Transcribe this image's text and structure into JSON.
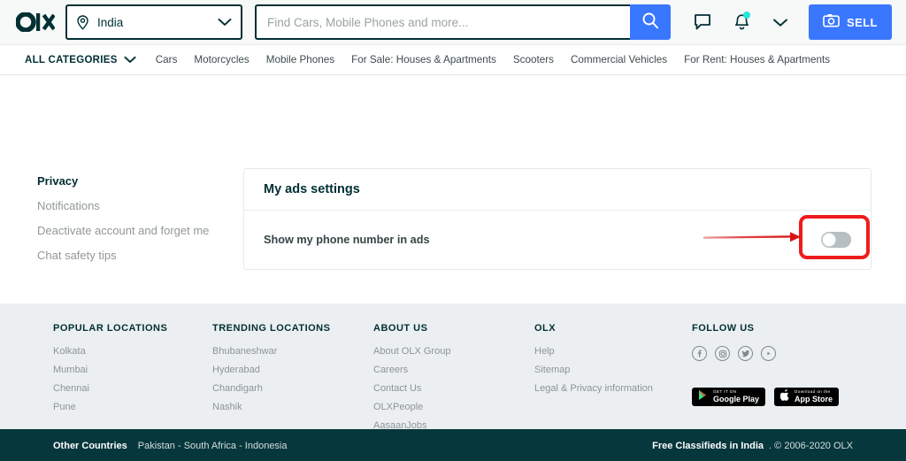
{
  "header": {
    "logo_alt": "olx-logo",
    "location": {
      "value": "India",
      "icon": "location-pin-icon",
      "chevron": "chevron-down-icon"
    },
    "search": {
      "placeholder": "Find Cars, Mobile Phones and more...",
      "value": "",
      "button_icon": "search-icon"
    },
    "icons": [
      {
        "name": "chat-icon",
        "badge": false
      },
      {
        "name": "bell-icon",
        "badge": true
      },
      {
        "name": "chevron-down-icon",
        "badge": false
      }
    ],
    "sell": {
      "label": "SELL",
      "icon": "camera-icon"
    }
  },
  "categories": {
    "all_label": "ALL CATEGORIES",
    "all_icon": "chevron-down-icon",
    "items": [
      "Cars",
      "Motorcycles",
      "Mobile Phones",
      "For Sale: Houses & Apartments",
      "Scooters",
      "Commercial Vehicles",
      "For Rent: Houses & Apartments"
    ]
  },
  "sidebar": {
    "items": [
      {
        "label": "Privacy",
        "active": true
      },
      {
        "label": "Notifications",
        "active": false
      },
      {
        "label": "Deactivate account and forget me",
        "active": false
      },
      {
        "label": "Chat safety tips",
        "active": false
      }
    ]
  },
  "settings_card": {
    "title": "My ads settings",
    "rows": [
      {
        "label": "Show my phone number in ads",
        "toggle_state": "off",
        "toggle_name": "show-phone-number-toggle"
      }
    ]
  },
  "annotation": {
    "highlight_color": "#ee1c1c",
    "arrow_color": "#e23b3b",
    "target": "show-phone-number-toggle"
  },
  "footer": {
    "columns": [
      {
        "title": "POPULAR LOCATIONS",
        "links": [
          "Kolkata",
          "Mumbai",
          "Chennai",
          "Pune"
        ]
      },
      {
        "title": "TRENDING LOCATIONS",
        "links": [
          "Bhubaneshwar",
          "Hyderabad",
          "Chandigarh",
          "Nashik"
        ]
      },
      {
        "title": "ABOUT US",
        "links": [
          "About OLX Group",
          "Careers",
          "Contact Us",
          "OLXPeople",
          "AasaanJobs"
        ]
      },
      {
        "title": "OLX",
        "links": [
          "Help",
          "Sitemap",
          "Legal & Privacy information"
        ]
      }
    ],
    "follow": {
      "title": "FOLLOW US",
      "socials": [
        "facebook-icon",
        "instagram-icon",
        "twitter-icon",
        "youtube-icon"
      ]
    },
    "stores": [
      {
        "small": "GET IT ON",
        "big": "Google Play",
        "icon": "google-play-icon"
      },
      {
        "small": "Download on the",
        "big": "App Store",
        "icon": "apple-icon"
      }
    ]
  },
  "bottom_bar": {
    "other_countries_label": "Other Countries",
    "countries": "Pakistan - South Africa - Indonesia",
    "free_classifieds": "Free Classifieds in India",
    "copyright": ". © 2006-2020 OLX"
  }
}
